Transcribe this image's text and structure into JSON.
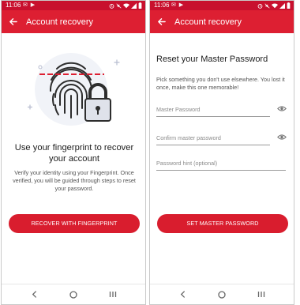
{
  "status_bar": {
    "time": "11:06",
    "notification_icons": "✉ ▶"
  },
  "screens": {
    "fingerprint": {
      "title": "Account recovery",
      "heading": "Use your fingerprint to recover your account",
      "body": "Verify your identity using your Fingerprint. Once verified, you will be guided through steps to reset your password.",
      "button_label": "RECOVER WITH FINGERPRINT"
    },
    "reset": {
      "title": "Account recovery",
      "heading": "Reset your Master Password",
      "body": "Pick something you don't use elsewhere. You lost it once, make this one memorable!",
      "fields": {
        "master_password": {
          "placeholder": "Master Password"
        },
        "confirm_password": {
          "placeholder": "Confirm master password"
        },
        "password_hint": {
          "placeholder": "Password hint (optional)"
        }
      },
      "button_label": "SET MASTER PASSWORD"
    }
  },
  "nav": {
    "back": "chevron-left-icon",
    "home": "home-circle-icon",
    "recents": "recents-icon"
  },
  "colors": {
    "status_bar": "#c8102e",
    "app_bar": "#dd1f32",
    "button": "#d91d2e"
  }
}
